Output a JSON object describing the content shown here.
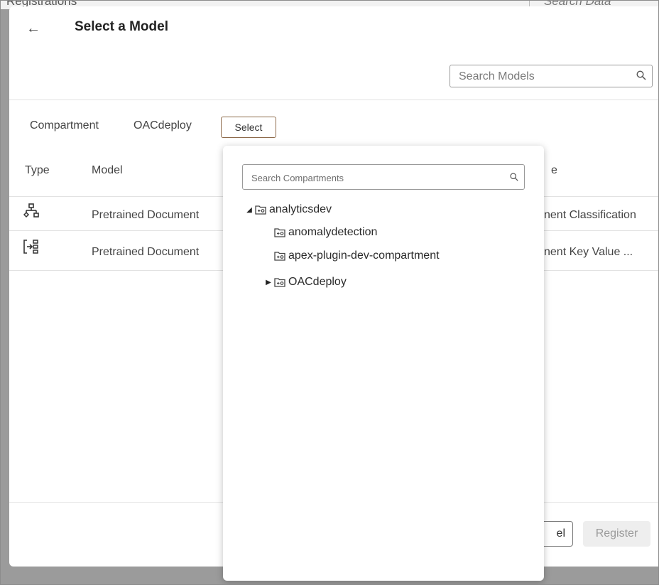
{
  "background": {
    "left_text": "Registrations",
    "right_text": "Search Data"
  },
  "dialog": {
    "title": "Select a Model",
    "search_placeholder": "Search Models",
    "compartment_label": "Compartment",
    "compartment_value": "OACdeploy",
    "select_label": "Select",
    "columns": {
      "type": "Type",
      "model": "Model",
      "partial": "e"
    },
    "rows": [
      {
        "icon": "classification-tree-icon",
        "model": "Pretrained Document",
        "type_text": "nent Classification"
      },
      {
        "icon": "key-value-icon",
        "model": "Pretrained Document",
        "type_text": "nent Key Value ..."
      }
    ],
    "footer": {
      "cancel_partial": "el",
      "register_label": "Register"
    }
  },
  "popup": {
    "search_placeholder": "Search Compartments",
    "tree": [
      {
        "label": "analyticsdev",
        "toggle": "◢",
        "level": 0
      },
      {
        "label": "anomalydetection",
        "toggle": "",
        "level": 1
      },
      {
        "label": "apex-plugin-dev-compartment",
        "toggle": "",
        "level": 1
      },
      {
        "label": "OACdeploy",
        "toggle": "▶",
        "level": 1
      }
    ]
  },
  "colors": {
    "accent_border": "#8d6a4a",
    "overlay": "#9b9b9b",
    "text": "#2e2e2e"
  }
}
